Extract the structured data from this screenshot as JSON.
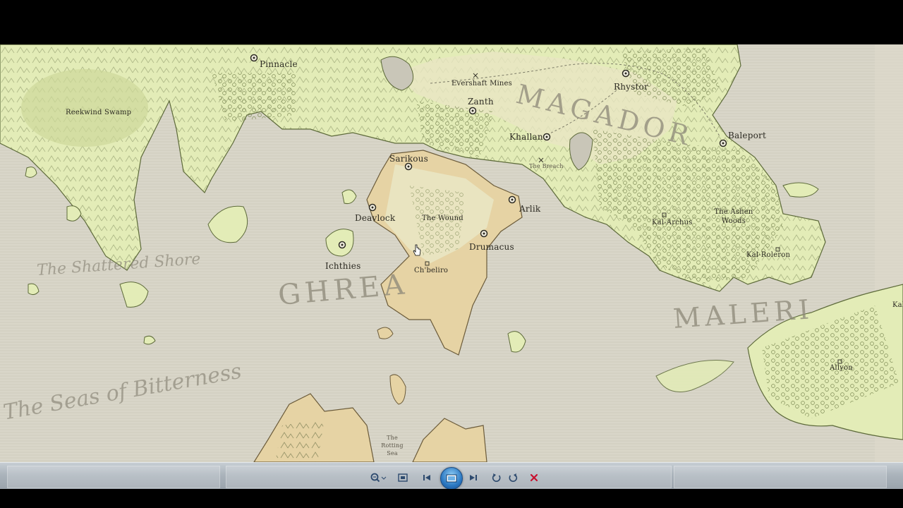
{
  "map": {
    "places": [
      {
        "id": "pinnacle",
        "label": "Pinnacle"
      },
      {
        "id": "reekwind-swamp",
        "label": "Reekwind Swamp"
      },
      {
        "id": "evershaft-mines",
        "label": "Evershaft Mines"
      },
      {
        "id": "zanth",
        "label": "Zanth"
      },
      {
        "id": "rhystor",
        "label": "Rhystor"
      },
      {
        "id": "khallan",
        "label": "Khallan"
      },
      {
        "id": "the-breach",
        "label": "The Breach"
      },
      {
        "id": "baleport",
        "label": "Baleport"
      },
      {
        "id": "sarikous",
        "label": "Sarikous"
      },
      {
        "id": "deavlock",
        "label": "Deavlock"
      },
      {
        "id": "the-wound",
        "label": "The Wound"
      },
      {
        "id": "arlik",
        "label": "Arlik"
      },
      {
        "id": "drumacus",
        "label": "Drumacus"
      },
      {
        "id": "ichthies",
        "label": "Ichthies"
      },
      {
        "id": "ch-beliro",
        "label": "Ch'beliro"
      },
      {
        "id": "kal-archus",
        "label": "Kal-Archus"
      },
      {
        "id": "the-ashen-woods",
        "label": "The Ashen Woods"
      },
      {
        "id": "kal-roleron",
        "label": "Kal-Roleron"
      },
      {
        "id": "kal",
        "label": "Kal"
      },
      {
        "id": "allyon",
        "label": "Allyon"
      },
      {
        "id": "the-rotting-sea",
        "label": "The Rotting Sea"
      }
    ],
    "regions": {
      "magador": "MAGADOR",
      "ghrea": "GHREA",
      "maleri": "MALERI"
    },
    "seas": {
      "shattered_shore": "The Shattered Shore",
      "seas_of_bitterness": "The Seas of Bitterness"
    }
  },
  "toolbar": {
    "buttons": [
      {
        "id": "zoom",
        "icon": "zoom-icon"
      },
      {
        "id": "fit",
        "icon": "fit-window-icon"
      },
      {
        "id": "previous",
        "icon": "previous-icon"
      },
      {
        "id": "slideshow",
        "icon": "slideshow-icon"
      },
      {
        "id": "next",
        "icon": "next-icon"
      },
      {
        "id": "rotate-ccw",
        "icon": "rotate-counterclockwise-icon"
      },
      {
        "id": "rotate-cw",
        "icon": "rotate-clockwise-icon"
      },
      {
        "id": "delete",
        "icon": "delete-icon"
      }
    ],
    "colors": {
      "delete": "#c8102e",
      "slideshow": "#2b78c2"
    }
  },
  "colors": {
    "land_green": "#e3ecb7",
    "land_tan": "#e6d3a4",
    "sea": "#d8d5c8"
  }
}
